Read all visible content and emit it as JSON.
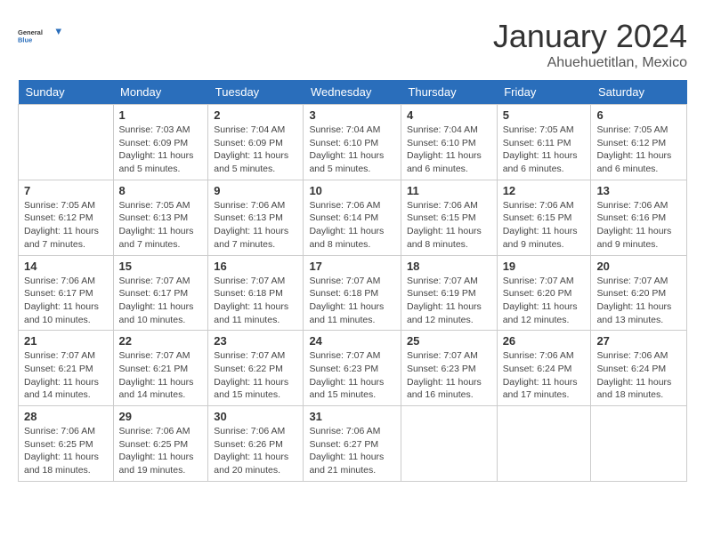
{
  "header": {
    "logo": {
      "general": "General",
      "blue": "Blue"
    },
    "month": "January 2024",
    "location": "Ahuehuetitlan, Mexico"
  },
  "weekdays": [
    "Sunday",
    "Monday",
    "Tuesday",
    "Wednesday",
    "Thursday",
    "Friday",
    "Saturday"
  ],
  "weeks": [
    [
      {
        "day": "",
        "info": ""
      },
      {
        "day": "1",
        "info": "Sunrise: 7:03 AM\nSunset: 6:09 PM\nDaylight: 11 hours\nand 5 minutes."
      },
      {
        "day": "2",
        "info": "Sunrise: 7:04 AM\nSunset: 6:09 PM\nDaylight: 11 hours\nand 5 minutes."
      },
      {
        "day": "3",
        "info": "Sunrise: 7:04 AM\nSunset: 6:10 PM\nDaylight: 11 hours\nand 5 minutes."
      },
      {
        "day": "4",
        "info": "Sunrise: 7:04 AM\nSunset: 6:10 PM\nDaylight: 11 hours\nand 6 minutes."
      },
      {
        "day": "5",
        "info": "Sunrise: 7:05 AM\nSunset: 6:11 PM\nDaylight: 11 hours\nand 6 minutes."
      },
      {
        "day": "6",
        "info": "Sunrise: 7:05 AM\nSunset: 6:12 PM\nDaylight: 11 hours\nand 6 minutes."
      }
    ],
    [
      {
        "day": "7",
        "info": "Sunrise: 7:05 AM\nSunset: 6:12 PM\nDaylight: 11 hours\nand 7 minutes."
      },
      {
        "day": "8",
        "info": "Sunrise: 7:05 AM\nSunset: 6:13 PM\nDaylight: 11 hours\nand 7 minutes."
      },
      {
        "day": "9",
        "info": "Sunrise: 7:06 AM\nSunset: 6:13 PM\nDaylight: 11 hours\nand 7 minutes."
      },
      {
        "day": "10",
        "info": "Sunrise: 7:06 AM\nSunset: 6:14 PM\nDaylight: 11 hours\nand 8 minutes."
      },
      {
        "day": "11",
        "info": "Sunrise: 7:06 AM\nSunset: 6:15 PM\nDaylight: 11 hours\nand 8 minutes."
      },
      {
        "day": "12",
        "info": "Sunrise: 7:06 AM\nSunset: 6:15 PM\nDaylight: 11 hours\nand 9 minutes."
      },
      {
        "day": "13",
        "info": "Sunrise: 7:06 AM\nSunset: 6:16 PM\nDaylight: 11 hours\nand 9 minutes."
      }
    ],
    [
      {
        "day": "14",
        "info": "Sunrise: 7:06 AM\nSunset: 6:17 PM\nDaylight: 11 hours\nand 10 minutes."
      },
      {
        "day": "15",
        "info": "Sunrise: 7:07 AM\nSunset: 6:17 PM\nDaylight: 11 hours\nand 10 minutes."
      },
      {
        "day": "16",
        "info": "Sunrise: 7:07 AM\nSunset: 6:18 PM\nDaylight: 11 hours\nand 11 minutes."
      },
      {
        "day": "17",
        "info": "Sunrise: 7:07 AM\nSunset: 6:18 PM\nDaylight: 11 hours\nand 11 minutes."
      },
      {
        "day": "18",
        "info": "Sunrise: 7:07 AM\nSunset: 6:19 PM\nDaylight: 11 hours\nand 12 minutes."
      },
      {
        "day": "19",
        "info": "Sunrise: 7:07 AM\nSunset: 6:20 PM\nDaylight: 11 hours\nand 12 minutes."
      },
      {
        "day": "20",
        "info": "Sunrise: 7:07 AM\nSunset: 6:20 PM\nDaylight: 11 hours\nand 13 minutes."
      }
    ],
    [
      {
        "day": "21",
        "info": "Sunrise: 7:07 AM\nSunset: 6:21 PM\nDaylight: 11 hours\nand 14 minutes."
      },
      {
        "day": "22",
        "info": "Sunrise: 7:07 AM\nSunset: 6:21 PM\nDaylight: 11 hours\nand 14 minutes."
      },
      {
        "day": "23",
        "info": "Sunrise: 7:07 AM\nSunset: 6:22 PM\nDaylight: 11 hours\nand 15 minutes."
      },
      {
        "day": "24",
        "info": "Sunrise: 7:07 AM\nSunset: 6:23 PM\nDaylight: 11 hours\nand 15 minutes."
      },
      {
        "day": "25",
        "info": "Sunrise: 7:07 AM\nSunset: 6:23 PM\nDaylight: 11 hours\nand 16 minutes."
      },
      {
        "day": "26",
        "info": "Sunrise: 7:06 AM\nSunset: 6:24 PM\nDaylight: 11 hours\nand 17 minutes."
      },
      {
        "day": "27",
        "info": "Sunrise: 7:06 AM\nSunset: 6:24 PM\nDaylight: 11 hours\nand 18 minutes."
      }
    ],
    [
      {
        "day": "28",
        "info": "Sunrise: 7:06 AM\nSunset: 6:25 PM\nDaylight: 11 hours\nand 18 minutes."
      },
      {
        "day": "29",
        "info": "Sunrise: 7:06 AM\nSunset: 6:25 PM\nDaylight: 11 hours\nand 19 minutes."
      },
      {
        "day": "30",
        "info": "Sunrise: 7:06 AM\nSunset: 6:26 PM\nDaylight: 11 hours\nand 20 minutes."
      },
      {
        "day": "31",
        "info": "Sunrise: 7:06 AM\nSunset: 6:27 PM\nDaylight: 11 hours\nand 21 minutes."
      },
      {
        "day": "",
        "info": ""
      },
      {
        "day": "",
        "info": ""
      },
      {
        "day": "",
        "info": ""
      }
    ]
  ]
}
